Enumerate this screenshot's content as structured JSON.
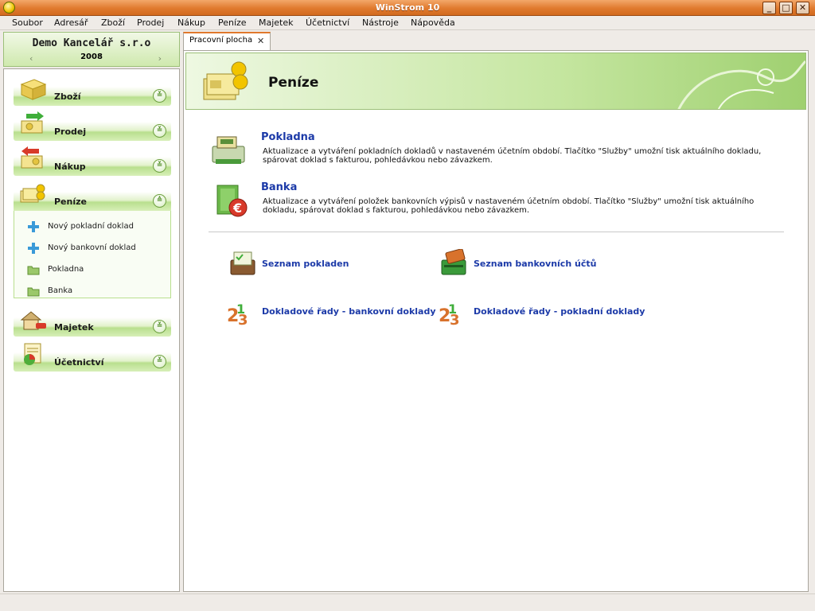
{
  "window": {
    "title": "WinStrom 10",
    "min_btn": "_",
    "max_btn": "□",
    "close_btn": "✕"
  },
  "menu": [
    {
      "label": "Soubor"
    },
    {
      "label": "Adresář"
    },
    {
      "label": "Zboží"
    },
    {
      "label": "Prodej"
    },
    {
      "label": "Nákup"
    },
    {
      "label": "Peníze"
    },
    {
      "label": "Majetek"
    },
    {
      "label": "Účetnictví"
    },
    {
      "label": "Nástroje"
    },
    {
      "label": "Nápověda"
    }
  ],
  "company": {
    "name": "Demo Kancelář s.r.o",
    "year": "2008",
    "prev": "‹",
    "next": "›"
  },
  "sections": [
    {
      "label": "Zboží",
      "chevron": "≚",
      "icon": "goods-box-icon"
    },
    {
      "label": "Prodej",
      "chevron": "≚",
      "icon": "sales-icon"
    },
    {
      "label": "Nákup",
      "chevron": "≚",
      "icon": "purchase-icon"
    },
    {
      "label": "Peníze",
      "chevron": "≙",
      "icon": "money-icon",
      "expanded": true
    },
    {
      "label": "Majetek",
      "chevron": "≚",
      "icon": "property-icon"
    },
    {
      "label": "Účetnictví",
      "chevron": "≚",
      "icon": "accounting-icon"
    }
  ],
  "money_items": [
    {
      "label": "Nový pokladní doklad",
      "icon": "plus-icon"
    },
    {
      "label": "Nový bankovní doklad",
      "icon": "plus-icon"
    },
    {
      "label": "Pokladna",
      "icon": "folder-icon"
    },
    {
      "label": "Banka",
      "icon": "folder-icon"
    }
  ],
  "tab": {
    "label": "Pracovní plocha",
    "close": "✕"
  },
  "banner": {
    "title": "Peníze"
  },
  "entries": [
    {
      "title": "Pokladna",
      "desc_line1": "Aktualizace a vytváření pokladních dokladů v nastaveném účetním období. Tlačítko \"Služby\" umožní tisk aktuálního dokladu,",
      "desc_line2": "spárovat doklad s fakturou, pohledávkou nebo závazkem."
    },
    {
      "title": "Banka",
      "desc_line1": "Aktualizace a vytváření položek bankovních výpisů v nastaveném účetním období. Tlačítko \"Služby\" umožní tisk aktuálního",
      "desc_line2": "dokladu, spárovat doklad s fakturou, pohledávkou nebo závazkem."
    }
  ],
  "links": [
    {
      "label": "Seznam pokladen",
      "icon": "cash-register-list-icon"
    },
    {
      "label": "Seznam bankovních účtů",
      "icon": "bank-card-icon"
    },
    {
      "label": "Dokladové řady - bankovní doklady",
      "icon": "number-series-icon"
    },
    {
      "label": "Dokladové řady - pokladní doklady",
      "icon": "number-series-icon"
    }
  ],
  "colors": {
    "accent_green": "#b9df8e",
    "link_blue": "#1c3aa8",
    "title_orange": "#e07a2e"
  }
}
